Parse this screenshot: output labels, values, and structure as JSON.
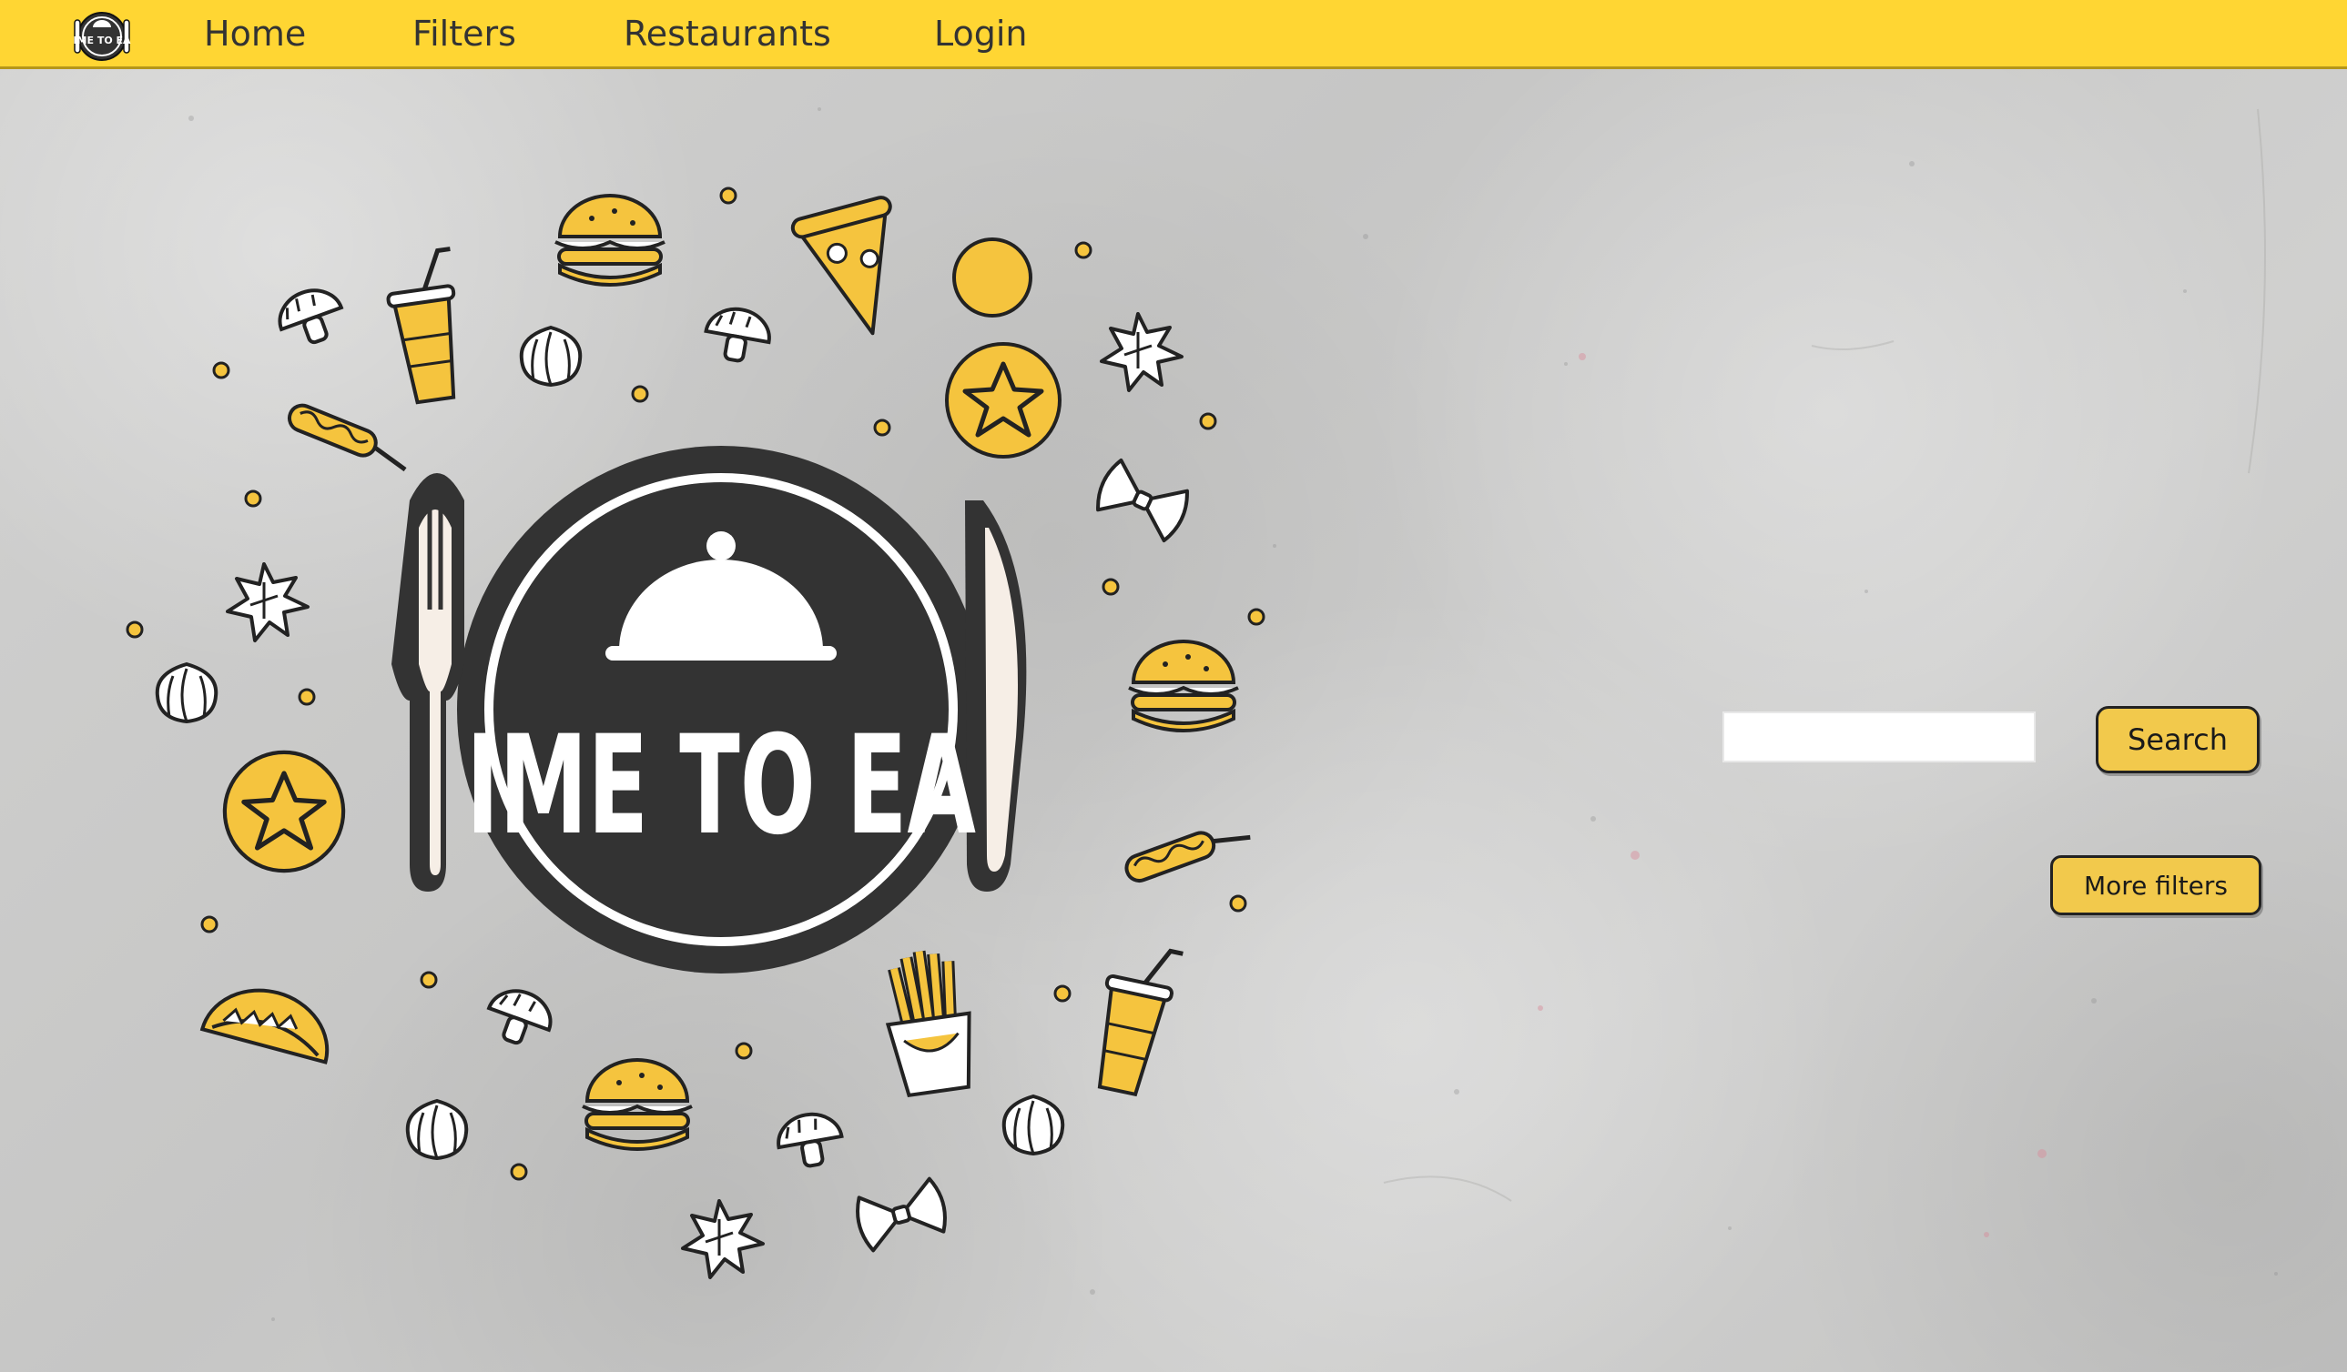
{
  "theme": {
    "accent": "#FFD633",
    "button": "#F2C94C",
    "logo_dark": "#333333",
    "food_yellow": "#F5C43E"
  },
  "navbar": {
    "logo_text": "IME TO EA",
    "links": [
      {
        "label": "Home"
      },
      {
        "label": "Filters"
      },
      {
        "label": "Restaurants"
      },
      {
        "label": "Login"
      }
    ]
  },
  "hero": {
    "logo_text": "IME TO EA",
    "icons": [
      "burger-icon",
      "pizza-icon",
      "taco-icon",
      "fries-icon",
      "drink-cup-icon",
      "corn-dog-icon",
      "mushroom-icon",
      "bow-pasta-icon",
      "leaf-icon",
      "starfruit-icon",
      "cloche-icon",
      "fork-icon",
      "knife-icon"
    ]
  },
  "search": {
    "input_value": "",
    "placeholder": "",
    "button_label": "Search"
  },
  "filters": {
    "more_filters_label": "More filters"
  }
}
